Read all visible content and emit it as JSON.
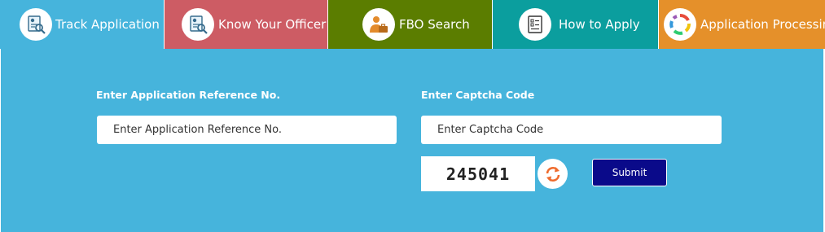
{
  "tabs": [
    {
      "label": "Track Application",
      "icon": "magnifier-document-icon",
      "color": "#46b4dc"
    },
    {
      "label": "Know Your Officer",
      "icon": "magnifier-document-icon",
      "color": "#cd5c64"
    },
    {
      "label": "FBO Search",
      "icon": "person-briefcase-icon",
      "color": "#5b7d00"
    },
    {
      "label": "How to Apply",
      "icon": "checklist-document-icon",
      "color": "#0b9e9e"
    },
    {
      "label": "Application Processing",
      "icon": "cycle-arrows-icon",
      "color": "#e5902a"
    }
  ],
  "form": {
    "ref_label": "Enter Application Reference No.",
    "ref_placeholder": "Enter Application Reference No.",
    "captcha_label": "Enter Captcha Code",
    "captcha_placeholder": "Enter Captcha Code",
    "captcha_value": "245041",
    "submit_label": "Submit"
  },
  "colors": {
    "panel": "#46b4dc",
    "submit": "#0a0a8a",
    "refresh": "#ef6b2d"
  }
}
